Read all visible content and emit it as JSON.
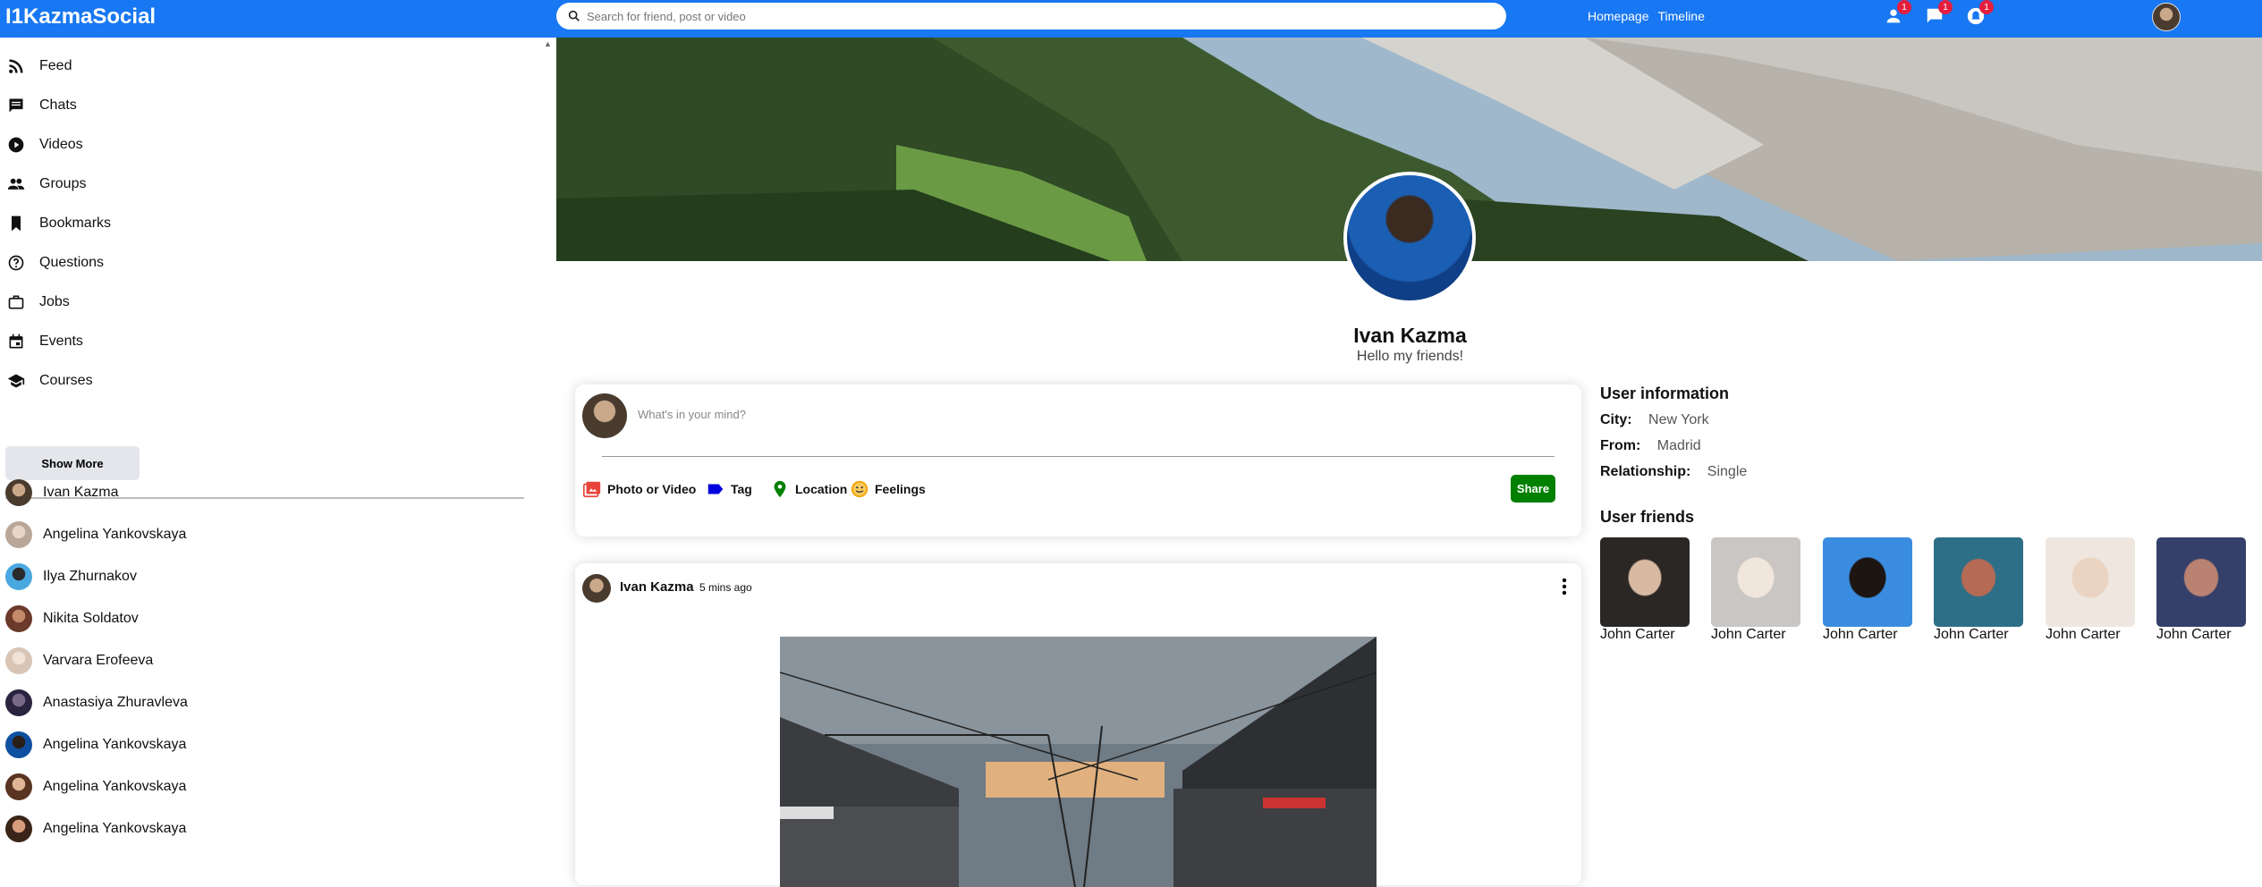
{
  "app": {
    "logo": "I1KazmaSocial"
  },
  "search": {
    "placeholder": "Search for friend, post or video"
  },
  "topbar": {
    "links": [
      "Homepage",
      "Timeline"
    ],
    "badges": {
      "person": "1",
      "chat": "1",
      "notifications": "1"
    }
  },
  "sidebar": {
    "items": [
      {
        "label": "Feed",
        "icon": "rss-feed-icon"
      },
      {
        "label": "Chats",
        "icon": "chat-icon"
      },
      {
        "label": "Videos",
        "icon": "play-circle-icon"
      },
      {
        "label": "Groups",
        "icon": "group-icon"
      },
      {
        "label": "Bookmarks",
        "icon": "bookmark-icon"
      },
      {
        "label": "Questions",
        "icon": "help-outline-icon"
      },
      {
        "label": "Jobs",
        "icon": "work-outline-icon"
      },
      {
        "label": "Events",
        "icon": "event-icon"
      },
      {
        "label": "Courses",
        "icon": "school-icon"
      }
    ],
    "show_more": "Show More",
    "friends": [
      "Ivan Kazma",
      "Angelina Yankovskaya",
      "Ilya Zhurnakov",
      "Nikita Soldatov",
      "Varvara Erofeeva",
      "Anastasiya Zhuravleva",
      "Angelina Yankovskaya",
      "Angelina Yankovskaya",
      "Angelina Yankovskaya"
    ]
  },
  "profile": {
    "name": "Ivan Kazma",
    "description": "Hello my friends!"
  },
  "share": {
    "placeholder": "What's in your mind?",
    "options": [
      "Photo or Video",
      "Tag",
      "Location",
      "Feelings"
    ],
    "button": "Share"
  },
  "post": {
    "username": "Ivan Kazma",
    "time": "5 mins ago"
  },
  "user_info": {
    "title": "User information",
    "rows": [
      {
        "key": "City:",
        "value": "New York"
      },
      {
        "key": "From:",
        "value": "Madrid"
      },
      {
        "key": "Relationship:",
        "value": "Single"
      }
    ]
  },
  "user_friends": {
    "title": "User friends",
    "names": [
      "John Carter",
      "John Carter",
      "John Carter",
      "John Carter",
      "John Carter",
      "John Carter"
    ]
  },
  "colors": {
    "topbar": "#1877f2",
    "share_button": "#008000",
    "badge": "#e41e3f"
  }
}
